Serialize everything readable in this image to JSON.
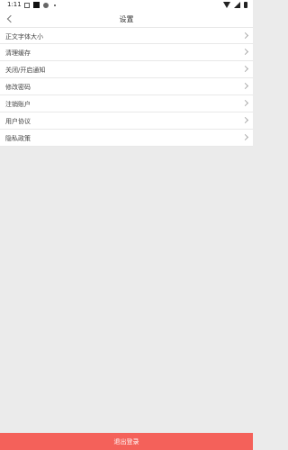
{
  "status_bar": {
    "time": "1:11"
  },
  "header": {
    "title": "设置"
  },
  "menu": {
    "items": [
      {
        "label": "正文字体大小"
      },
      {
        "label": "清理缓存"
      },
      {
        "label": "关闭/开启通知"
      },
      {
        "label": "修改密码"
      },
      {
        "label": "注销账户"
      },
      {
        "label": "用户协议"
      },
      {
        "label": "隐私政策"
      }
    ]
  },
  "footer": {
    "logout_label": "退出登录"
  },
  "colors": {
    "accent": "#f4615a",
    "background": "#ebebeb",
    "surface": "#ffffff"
  }
}
